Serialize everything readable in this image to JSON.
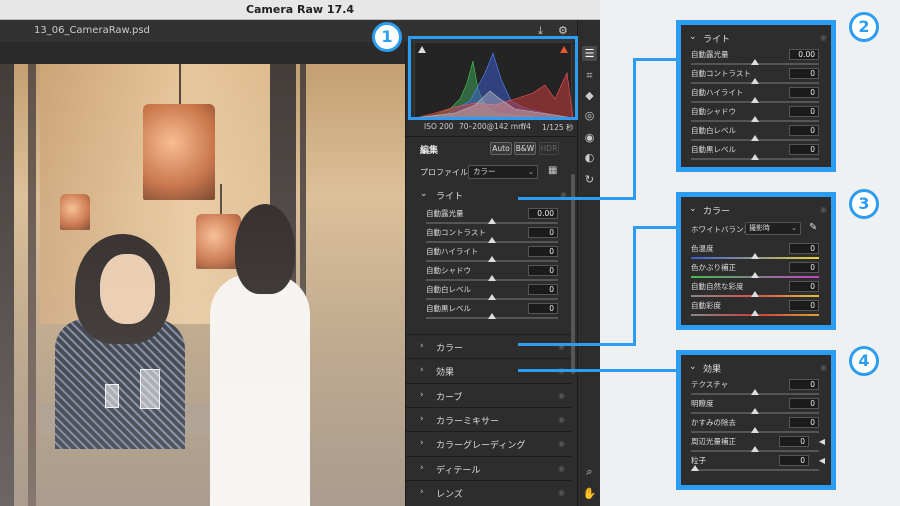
{
  "window": {
    "title": "Camera Raw 17.4",
    "filename": "13_06_CameraRaw.psd"
  },
  "camera_info": {
    "iso": "ISO 200",
    "lens": "70–200@142 mm",
    "aperture": "f/4",
    "shutter": "1/125 秒"
  },
  "edit": {
    "title": "編集",
    "buttons": [
      "Auto",
      "B&W",
      "HDR"
    ],
    "profile_label": "プロファイル",
    "profile_value": "カラー"
  },
  "light": {
    "title": "ライト",
    "sliders": [
      {
        "label": "自動露光量",
        "value": "0.00"
      },
      {
        "label": "自動コントラスト",
        "value": "0"
      },
      {
        "label": "自動ハイライト",
        "value": "0"
      },
      {
        "label": "自動シャドウ",
        "value": "0"
      },
      {
        "label": "自動白レベル",
        "value": "0"
      },
      {
        "label": "自動黒レベル",
        "value": "0"
      }
    ]
  },
  "color": {
    "title": "カラー",
    "wb_label": "ホワイトバランス",
    "wb_value": "撮影時",
    "sliders": [
      {
        "label": "色温度",
        "value": "0"
      },
      {
        "label": "色かぶり補正",
        "value": "0"
      },
      {
        "label": "自動自然な彩度",
        "value": "0"
      },
      {
        "label": "自動彩度",
        "value": "0"
      }
    ]
  },
  "effects": {
    "title": "効果",
    "sliders": [
      {
        "label": "テクスチャ",
        "value": "0"
      },
      {
        "label": "明瞭度",
        "value": "0"
      },
      {
        "label": "かすみの除去",
        "value": "0"
      },
      {
        "label": "周辺光量補正",
        "value": "0"
      },
      {
        "label": "粒子",
        "value": "0"
      }
    ]
  },
  "collapsed_sections": [
    "カラー",
    "効果",
    "カーブ",
    "カラーミキサー",
    "カラーグレーディング",
    "ディテール",
    "レンズ"
  ],
  "callout_numbers": [
    "1",
    "2",
    "3",
    "4"
  ],
  "icons": {
    "chevron_down": "⌄",
    "chevron_right": "›",
    "eye": "◉",
    "save": "⤓",
    "gear": "⚙",
    "expand": "⤢",
    "dropper": "✎",
    "grid": "▦",
    "zoom": "⌕",
    "hand": "✋"
  },
  "accent_color": "#2c9df0"
}
